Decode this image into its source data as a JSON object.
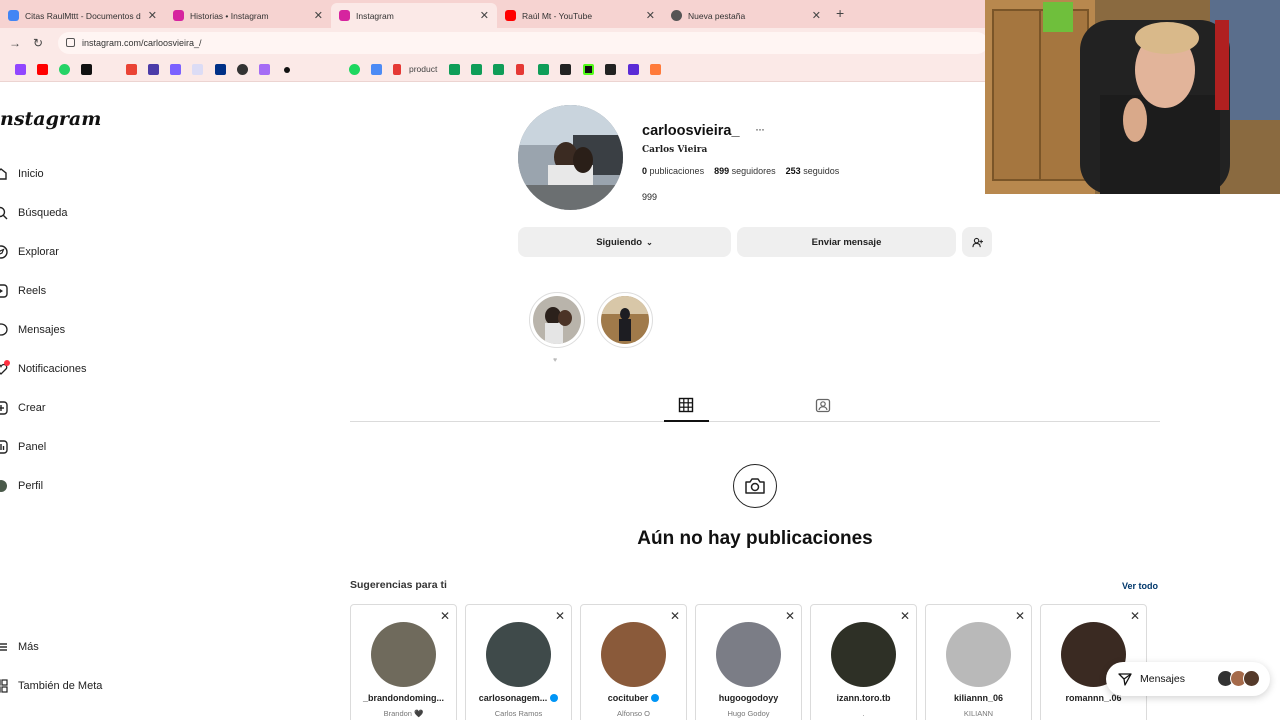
{
  "browser": {
    "tabs": [
      {
        "title": "Citas RaulMttt - Documentos d",
        "favicon_color": "#4285f4"
      },
      {
        "title": "Historias • Instagram",
        "favicon_color": "#d6249f"
      },
      {
        "title": "Instagram",
        "favicon_color": "#d6249f",
        "active": true
      },
      {
        "title": "Raúl Mt - YouTube",
        "favicon_color": "#ff0000"
      },
      {
        "title": "Nueva pestaña",
        "favicon_color": "#555555"
      }
    ],
    "new_tab_icon": "+",
    "url": "instagram.com/carloosvieira_/",
    "bookmark_text": "product"
  },
  "sidebar": {
    "logo": "nstagram",
    "items": [
      {
        "label": "Inicio",
        "icon": "home-icon"
      },
      {
        "label": "Búsqueda",
        "icon": "search-icon"
      },
      {
        "label": "Explorar",
        "icon": "compass-icon"
      },
      {
        "label": "Reels",
        "icon": "reels-icon"
      },
      {
        "label": "Mensajes",
        "icon": "messenger-icon"
      },
      {
        "label": "Notificaciones",
        "icon": "heart-icon"
      },
      {
        "label": "Crear",
        "icon": "plus-icon"
      },
      {
        "label": "Panel",
        "icon": "chart-icon"
      },
      {
        "label": "Perfil",
        "icon": "profile-icon"
      },
      {
        "label": "Más",
        "icon": "menu-icon"
      },
      {
        "label": "También de Meta",
        "icon": "meta-icon"
      }
    ]
  },
  "profile": {
    "username": "carloosvieira_",
    "full_name": "Carlos Vieira",
    "posts_count": "0",
    "posts_label": "publicaciones",
    "followers_count": "899",
    "followers_label": "seguidores",
    "following_count": "253",
    "following_label": "seguidos",
    "bio": "999",
    "following_button": "Siguiendo",
    "message_button": "Enviar mensaje",
    "highlight_label": "♥"
  },
  "content": {
    "empty_title": "Aún no hay publicaciones"
  },
  "suggestions": {
    "title": "Sugerencias para ti",
    "see_all": "Ver todo",
    "cards": [
      {
        "username": "_brandondoming...",
        "subtitle": "Brandon 🖤",
        "verified": false,
        "avatar_color": "#6f6a5c"
      },
      {
        "username": "carlosonagem...",
        "subtitle": "Carlos Ramos",
        "verified": true,
        "avatar_color": "#3f4a4a"
      },
      {
        "username": "cocituber",
        "subtitle": "Alfonso O",
        "verified": true,
        "avatar_color": "#8a5a3a"
      },
      {
        "username": "hugoogodoyy",
        "subtitle": "Hugo Godoy",
        "verified": false,
        "avatar_color": "#7b7d86"
      },
      {
        "username": "izann.toro.tb",
        "subtitle": ".",
        "verified": false,
        "avatar_color": "#2e3026"
      },
      {
        "username": "kiliannn_06",
        "subtitle": "KILIANN",
        "verified": false,
        "avatar_color": "#b9b9b9"
      },
      {
        "username": "romannn_.06",
        "subtitle": "",
        "verified": false,
        "avatar_color": "#3a2a22"
      }
    ]
  },
  "messages_pill": {
    "label": "Mensajes"
  },
  "colors": {
    "tabbar": "#f6d3d1",
    "accent_link": "#00376b",
    "verified": "#0095f6",
    "button_bg": "#efefef"
  }
}
